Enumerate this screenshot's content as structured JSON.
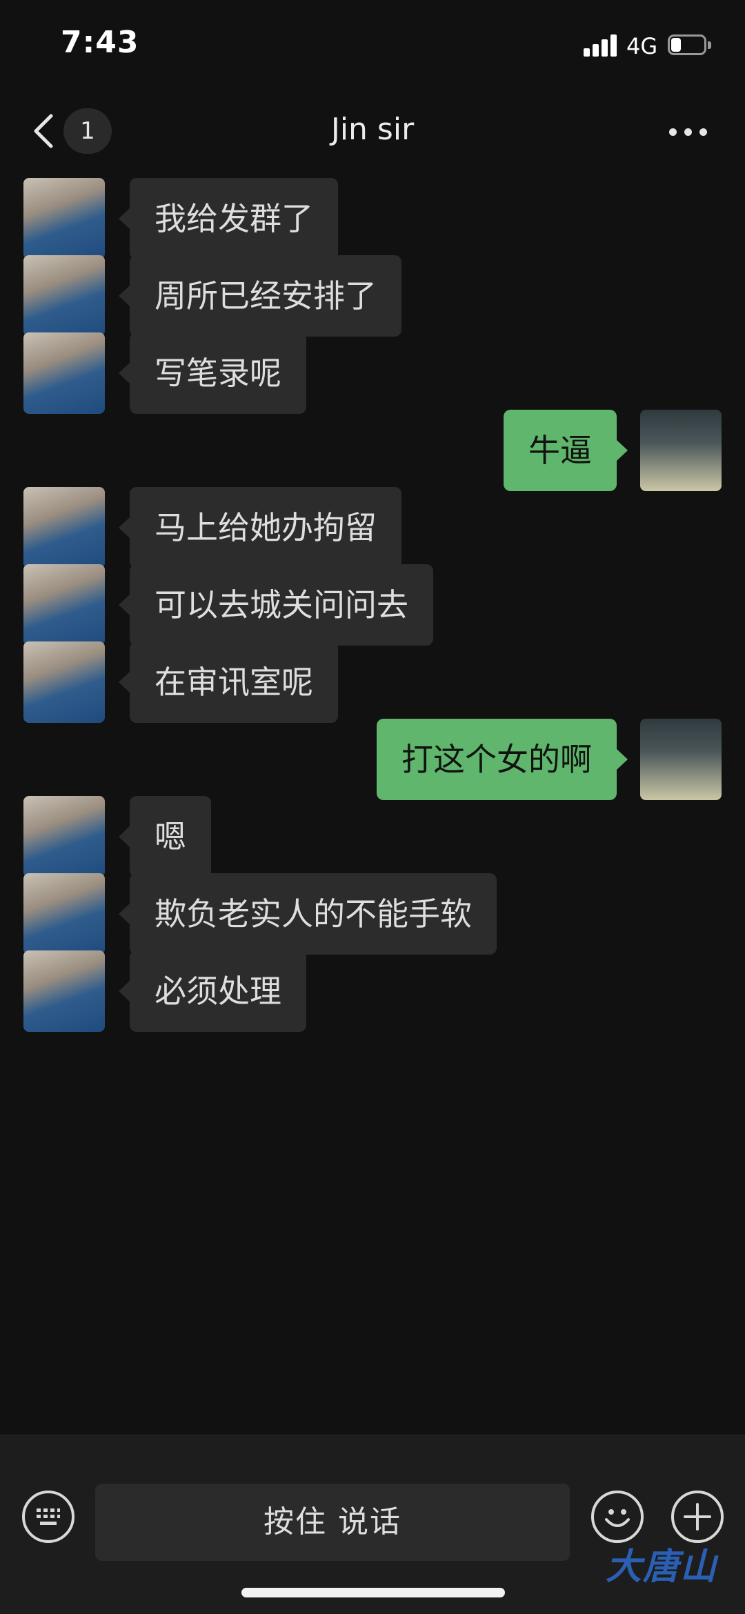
{
  "status_bar": {
    "time": "7:43",
    "network": "4G",
    "battery_level": 0.3
  },
  "nav": {
    "unread_count": "1",
    "title": "Jin sir"
  },
  "messages": [
    {
      "side": "left",
      "text": "我给发群了"
    },
    {
      "side": "left",
      "text": "周所已经安排了"
    },
    {
      "side": "left",
      "text": "写笔录呢"
    },
    {
      "side": "right",
      "text": "牛逼"
    },
    {
      "side": "left",
      "text": "马上给她办拘留"
    },
    {
      "side": "left",
      "text": "可以去城关问问去"
    },
    {
      "side": "left",
      "text": "在审讯室呢"
    },
    {
      "side": "right",
      "text": "打这个女的啊"
    },
    {
      "side": "left",
      "text": "嗯"
    },
    {
      "side": "left",
      "text": "欺负老实人的不能手软"
    },
    {
      "side": "left",
      "text": "必须处理"
    }
  ],
  "input_bar": {
    "hold_to_talk_label": "按住 说话"
  },
  "watermark": "大唐山",
  "colors": {
    "background": "#111111",
    "incoming_bubble": "#2c2c2c",
    "outgoing_bubble": "#5fb66c"
  },
  "icons": [
    "back-icon",
    "more-icon",
    "keyboard-icon",
    "emoji-icon",
    "plus-icon"
  ]
}
